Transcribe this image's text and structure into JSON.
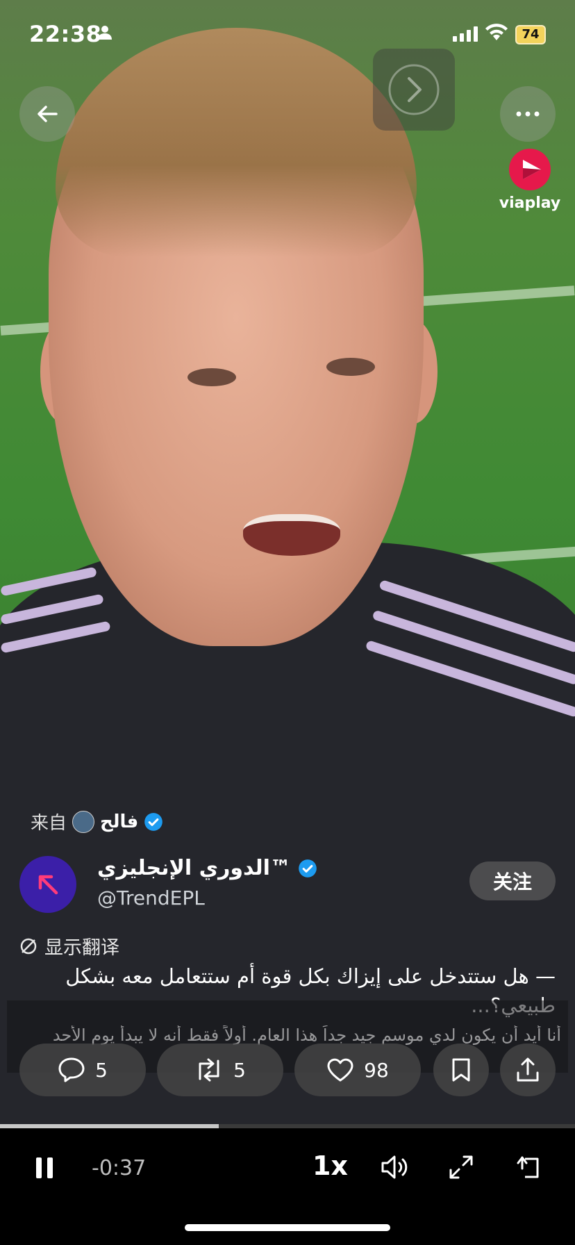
{
  "status_bar": {
    "time": "22:38",
    "battery": "74"
  },
  "overlay": {
    "brand_logo_text": "viaplay"
  },
  "post": {
    "from_prefix": "来自",
    "from_name": "فالح",
    "display_name": "الدوري الإنجليزي™",
    "handle": "@TrendEPL",
    "follow_label": "关注",
    "translate_label": "显示翻译",
    "caption": "— هل ستتدخل على إيزاك بكل قوة أم ستتعامل معه بشكل طبيعي؟...",
    "subtitle": "أنا أيد أن يكون لدي موسم جيد جداً هذا العام. أولاً فقط أنه لا يبدأ يوم الأحد"
  },
  "actions": {
    "replies": "5",
    "reposts": "5",
    "likes": "98"
  },
  "player": {
    "time_remaining": "-0:37",
    "speed": "1x",
    "progress": 0.38
  },
  "colors": {
    "verified_blue": "#1d9bf0",
    "avatar_bg": "#3b1fa8",
    "avatar_arrow": "#ff3b7a",
    "viaplay_pink": "#e6194b"
  }
}
